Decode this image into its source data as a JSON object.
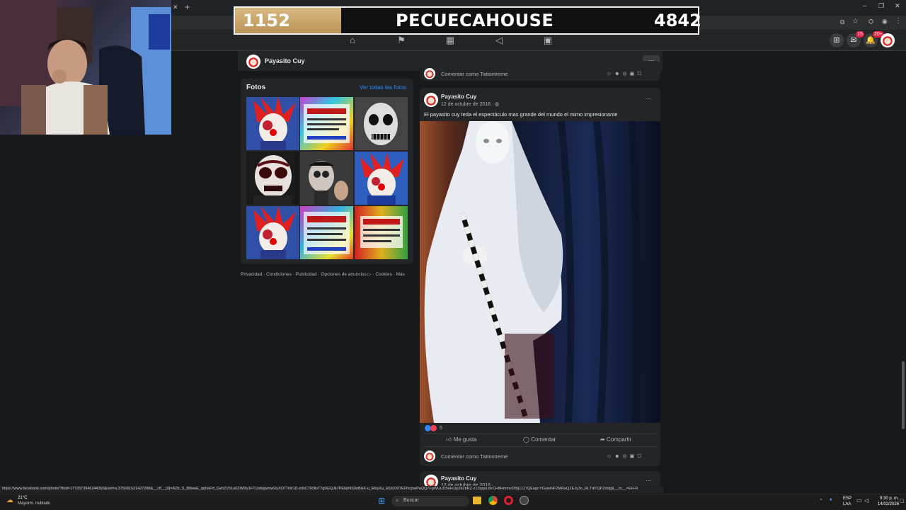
{
  "overlay": {
    "score_left": "1152",
    "title": "PECUECAHOUSE",
    "score_right": "4842"
  },
  "browser": {
    "url": "https://www.facebook.com/photo/?fbid=1772573946344393&set=a.375681521427288&__cft__[0]=AZb_S_B8weE_qqhaFrf_GxhZV51u6ZW9iy1FTUobqwmwUyXO7TiW1D-zdsC7R9lvT7g0GQJk7PE6pNS0oBAX-u_RlsyXu_R1kXXf7EFfscpwPaQQ7FgWUu1t5eH1Ip2b2bRZ-z13qqxLt9rCHffHmmvDBIj1127QEugnYGsiwNF2MRaQZEJy3o_RLTdiTQPZddg&__tn__=EH-R",
    "badge_messenger": "15",
    "badge_notif": "20+"
  },
  "page": {
    "name": "Payasito Cuy"
  },
  "photos": {
    "title": "Fotos",
    "see_all": "Ver todas las fotos"
  },
  "footer_links": "Privacidad · Condiciones · Publicidad · Opciones de anuncios ▷ · Cookies · Más",
  "comment_placeholder": "Comentar como Tattoxtreme",
  "post": {
    "author": "Payasito Cuy",
    "date": "12 de octubre de 2016 · ",
    "text": "El payasito cuy teda el espectáculo mas grande del mundo el mimo impresionante",
    "reactions": "5",
    "like": "Me gusta",
    "comment": "Comentar",
    "share": "Compartir"
  },
  "next_post": {
    "author": "Payasito Cuy",
    "date": "12 de octubre de 2016 · "
  },
  "taskbar": {
    "weather_temp": "21°C",
    "weather_desc": "Mayorm. nublado",
    "search": "Buscar",
    "lang1": "ESP",
    "lang2": "LAA",
    "time": "9:30 p. m.",
    "date": "14/02/2026"
  },
  "colors": {
    "fb_bg": "#18191a",
    "card": "#242526",
    "link": "#2d88ff",
    "score_gold": "#c9a56b"
  }
}
